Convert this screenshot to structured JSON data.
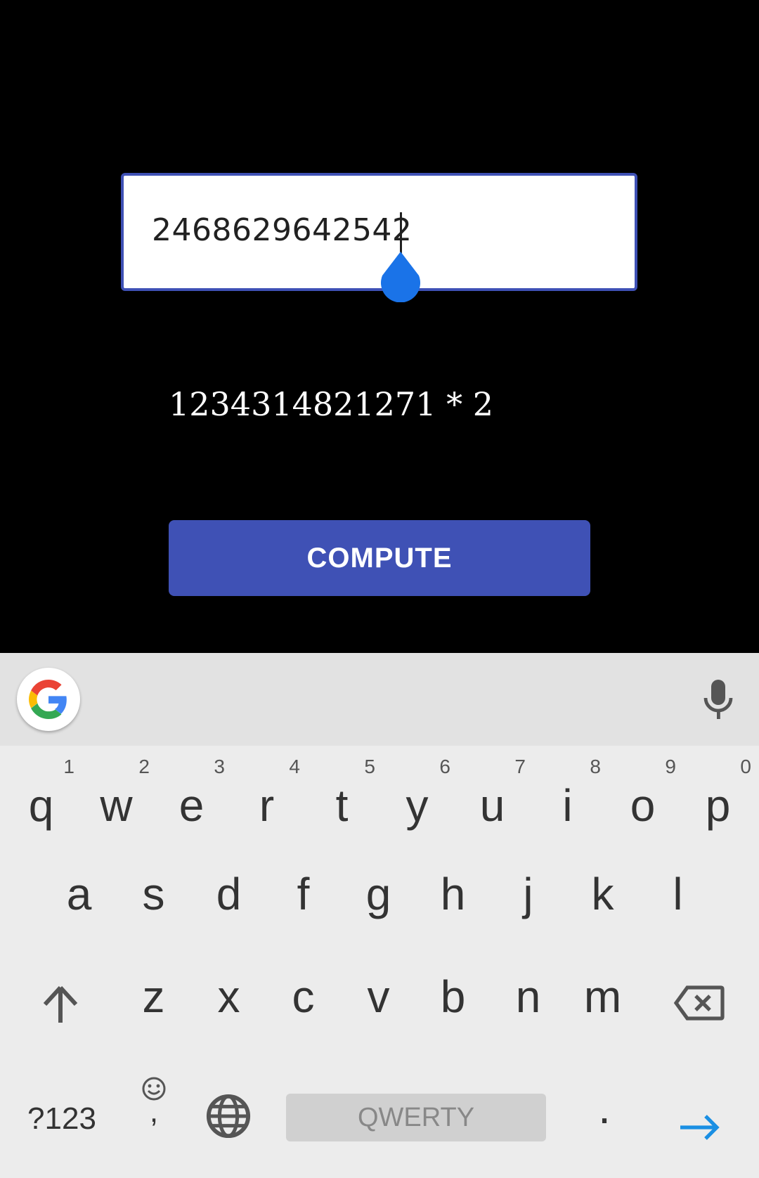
{
  "input": {
    "value": "2468629642542"
  },
  "expression": "1234314821271 * 2",
  "compute_button": {
    "label": "COMPUTE"
  },
  "colors": {
    "accent": "#3f51b5",
    "handle": "#1a73e8",
    "enter_arrow": "#1a8fe3"
  },
  "keyboard": {
    "row1": [
      {
        "key": "q",
        "hint": "1"
      },
      {
        "key": "w",
        "hint": "2"
      },
      {
        "key": "e",
        "hint": "3"
      },
      {
        "key": "r",
        "hint": "4"
      },
      {
        "key": "t",
        "hint": "5"
      },
      {
        "key": "y",
        "hint": "6"
      },
      {
        "key": "u",
        "hint": "7"
      },
      {
        "key": "i",
        "hint": "8"
      },
      {
        "key": "o",
        "hint": "9"
      },
      {
        "key": "p",
        "hint": "0"
      }
    ],
    "row2": [
      "a",
      "s",
      "d",
      "f",
      "g",
      "h",
      "j",
      "k",
      "l"
    ],
    "row3": [
      "z",
      "x",
      "c",
      "v",
      "b",
      "n",
      "m"
    ],
    "symbols_label": "?123",
    "comma_label": ",",
    "period_label": ".",
    "space_label": "QWERTY"
  }
}
